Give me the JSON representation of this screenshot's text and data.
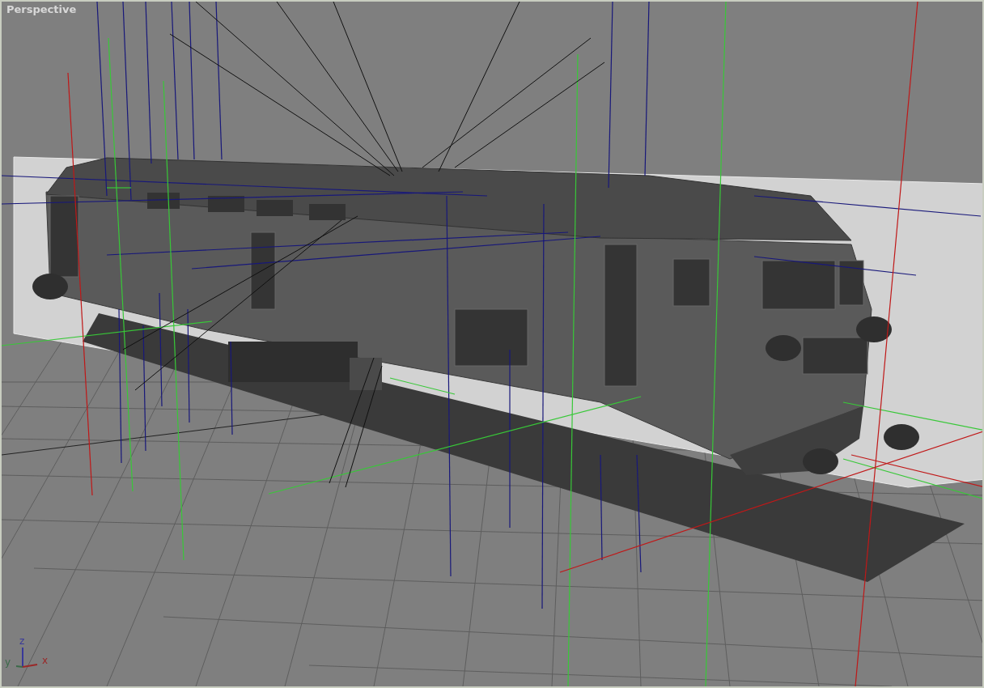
{
  "viewport": {
    "label": "Perspective"
  },
  "gizmo": {
    "axes": [
      {
        "kind": "up",
        "label": "z",
        "color": "#38389a"
      },
      {
        "kind": "left",
        "label": "y",
        "color": "#3a6a48"
      },
      {
        "kind": "right",
        "label": "x",
        "color": "#9a2828"
      }
    ]
  }
}
